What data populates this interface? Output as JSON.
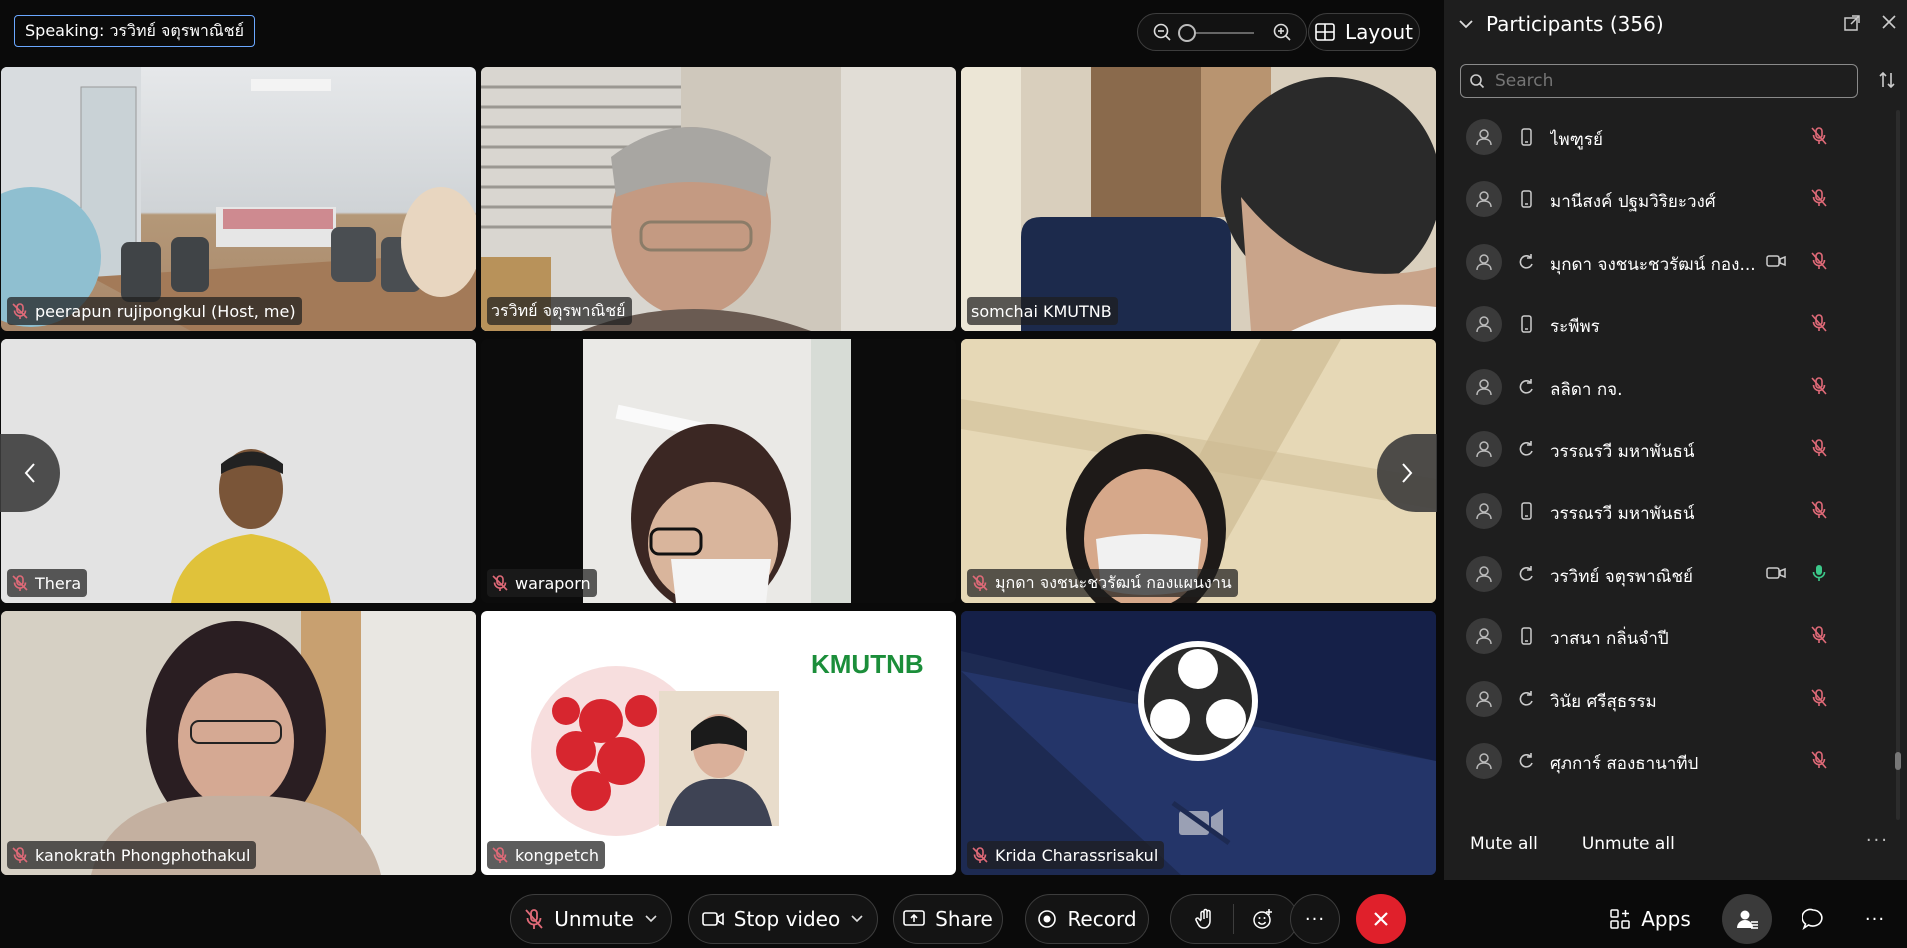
{
  "speaking": {
    "label": "Speaking: วรวิทย์ จตุรพาณิชย์"
  },
  "toolbar": {
    "layout_label": "Layout"
  },
  "tiles": [
    {
      "name": "peerapun rujipongkul (Host, me)"
    },
    {
      "name": "วรวิทย์ จตุรพาณิชย์"
    },
    {
      "name": "somchai KMUTNB"
    },
    {
      "name": "Thera"
    },
    {
      "name": "waraporn"
    },
    {
      "name": "มุกดา จงชนะชวรัฒน์ กองแผนงาน"
    },
    {
      "name": "kanokrath Phongphothakul"
    },
    {
      "name": "kongpetch"
    },
    {
      "name": "Krida Charassrisakul"
    }
  ],
  "kongpetch_logo": "KMUTNB",
  "participants": {
    "title": "Participants (356)",
    "search_placeholder": "Search",
    "items": [
      {
        "name": "ไพฑูรย์",
        "device": "phone",
        "video": false,
        "mic": "muted"
      },
      {
        "name": "มานีสงค์ ปฐมวิริยะวงศ์",
        "device": "phone",
        "video": false,
        "mic": "muted"
      },
      {
        "name": "มุกดา จงชนะชวรัฒน์ กอง...",
        "device": "sync",
        "video": true,
        "mic": "muted"
      },
      {
        "name": "ระพีพร",
        "device": "phone",
        "video": false,
        "mic": "muted"
      },
      {
        "name": "ลลิดา กจ.",
        "device": "sync",
        "video": false,
        "mic": "muted"
      },
      {
        "name": "วรรณรวี มหาพันธน์",
        "device": "sync",
        "video": false,
        "mic": "muted"
      },
      {
        "name": "วรรณรวี มหาพันธน์",
        "device": "phone",
        "video": false,
        "mic": "muted"
      },
      {
        "name": "วรวิทย์ จตุรพาณิชย์",
        "device": "sync",
        "video": true,
        "mic": "active"
      },
      {
        "name": "วาสนา กลิ่นจำปี",
        "device": "phone",
        "video": false,
        "mic": "muted"
      },
      {
        "name": "วินัย ศรีสุธรรม",
        "device": "sync",
        "video": false,
        "mic": "muted"
      },
      {
        "name": "ศุภการ์ สองธานาทีป",
        "device": "sync",
        "video": false,
        "mic": "muted"
      }
    ],
    "mute_all": "Mute all",
    "unmute_all": "Unmute all"
  },
  "controls": {
    "unmute": "Unmute",
    "stop_video": "Stop video",
    "share": "Share",
    "record": "Record",
    "apps": "Apps"
  },
  "colors": {
    "muted_mic": "#e06a78",
    "active_mic": "#3cc98a",
    "end_call": "#e0202b",
    "accent": "#6aa7ff"
  }
}
